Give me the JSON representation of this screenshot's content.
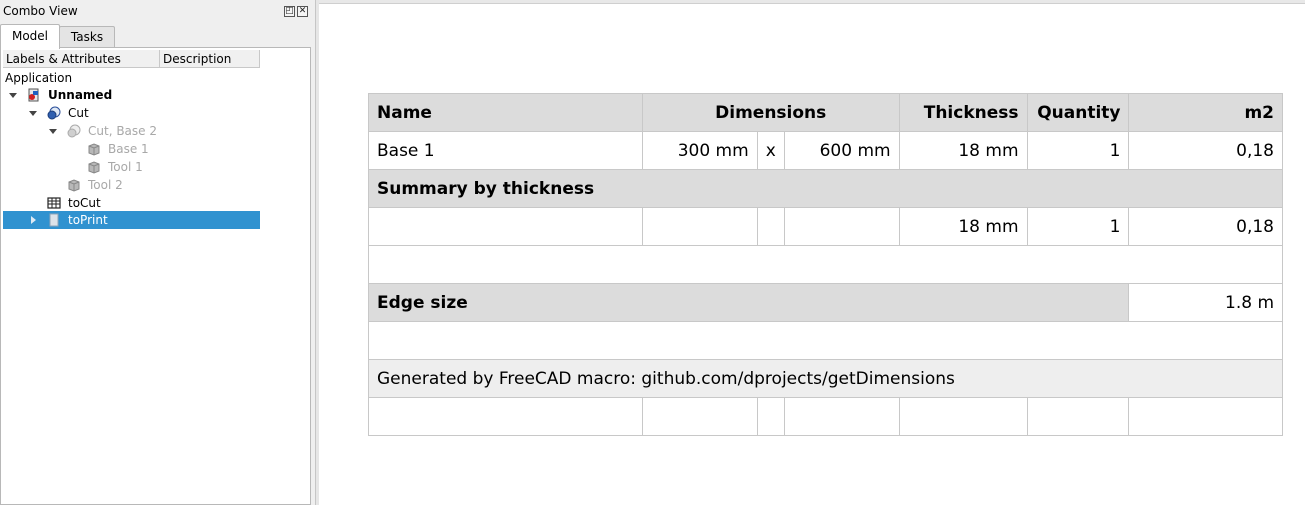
{
  "combo": {
    "title": "Combo View",
    "tabs": [
      {
        "label": "Model"
      },
      {
        "label": "Tasks"
      }
    ],
    "tree_header": {
      "col1": "Labels & Attributes",
      "col2": "Description"
    },
    "tree": {
      "application": "Application",
      "items": [
        {
          "label": "Unnamed"
        },
        {
          "label": "Cut"
        },
        {
          "label": "Cut, Base 2"
        },
        {
          "label": "Base 1"
        },
        {
          "label": "Tool 1"
        },
        {
          "label": "Tool 2"
        },
        {
          "label": "toCut"
        },
        {
          "label": "toPrint"
        }
      ]
    },
    "restore_glyph": "◰",
    "close_glyph": "✕"
  },
  "sheet": {
    "header": {
      "name": "Name",
      "dimensions": "Dimensions",
      "thickness": "Thickness",
      "quantity": "Quantity",
      "m2": "m2"
    },
    "row1": {
      "name": "Base 1",
      "dim1": "300 mm",
      "x": "x",
      "dim2": "600 mm",
      "thickness": "18 mm",
      "quantity": "1",
      "m2": "0,18"
    },
    "summary_title": "Summary by thickness",
    "summary_row": {
      "thickness": "18 mm",
      "quantity": "1",
      "m2": "0,18"
    },
    "edge_label": "Edge size",
    "edge_value": "1.8 m",
    "generated": "Generated by FreeCAD macro: github.com/dprojects/getDimensions"
  },
  "colors": {
    "selection": "#3092d0",
    "header_bg": "#dcdcdc",
    "generated_bg": "#eeeeee"
  }
}
